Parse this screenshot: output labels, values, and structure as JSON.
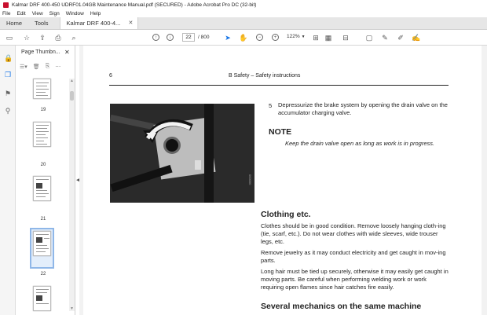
{
  "window": {
    "title": "Kalmar DRF 400-450 UDRF01.04GB Maintenance Manual.pdf (SECURED) - Adobe Acrobat Pro DC (32-bit)"
  },
  "menu": [
    "File",
    "Edit",
    "View",
    "Sign",
    "Window",
    "Help"
  ],
  "tabs": {
    "home": "Home",
    "tools": "Tools",
    "document": "Kalmar DRF 400-4..."
  },
  "toolbar": {
    "page_current": "22",
    "page_total": "/ 800",
    "zoom": "122%"
  },
  "thumbnails": {
    "title": "Page Thumbn...",
    "pages": [
      "19",
      "20",
      "21",
      "22"
    ],
    "selected": "22"
  },
  "page": {
    "number": "6",
    "header": "B Safety – Safety instructions",
    "step_number": "5",
    "step_text": "Depressurize the brake system by opening the drain valve on the accumulator charging valve.",
    "note_heading": "NOTE",
    "note_text": "Keep the drain valve open as long as work is in progress.",
    "photo_code": "000000",
    "clothing_heading": "Clothing etc.",
    "clothing_p1": "Clothes should be in good condition. Remove loosely hanging cloth-ing (tie, scarf, etc.). Do not wear clothes with wide sleeves, wide trouser legs, etc.",
    "clothing_p2": "Remove jewelry as it may conduct electricity and get caught in mov-ing parts.",
    "clothing_p3": "Long hair must be tied up securely, otherwise it may easily get caught in moving parts. Be careful when performing welding work or work requiring open flames since hair catches fire easily.",
    "mechanics_heading": "Several mechanics on the same machine"
  }
}
